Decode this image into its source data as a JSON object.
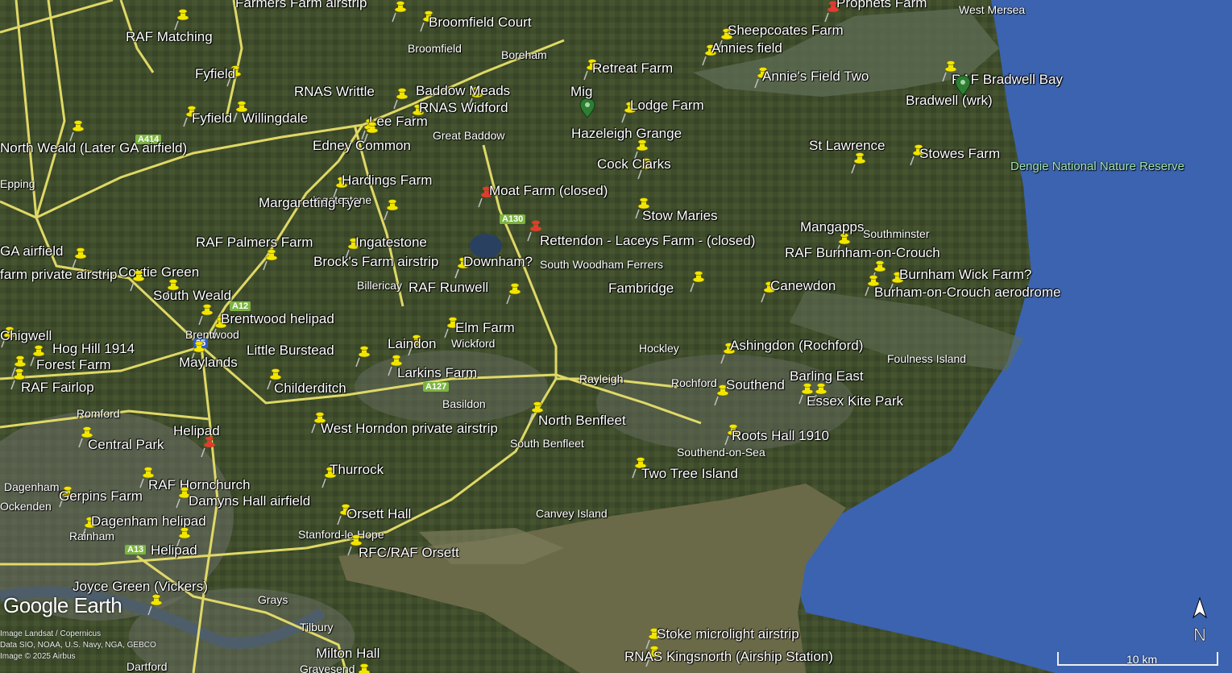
{
  "colors": {
    "land": "#3d4a2c",
    "sea": "#3b63b0",
    "estuary": "#6b6a48",
    "road": "#e8e06a",
    "pin_yellow": "#f2e600",
    "pin_red": "#e53935",
    "pin_green": "#2e7d32"
  },
  "logo": "Google Earth",
  "attribution": [
    "Image Landsat / Copernicus",
    "Data SIO, NOAA, U.S. Navy, NGA, GEBCO",
    "Image © 2025 Airbus"
  ],
  "scale_label": "10 km",
  "compass": "N",
  "places": [
    "West Mersea",
    "Broomfield",
    "Boreham",
    "Great Baddow",
    "Epping",
    "Ingatestone",
    "Billericay",
    "Brentwood",
    "Wickford",
    "Rayleigh",
    "Hockley",
    "Rochford",
    "Southminster",
    "Foulness Island",
    "Romford",
    "Basildon",
    "South Benfleet",
    "Southend-on-Sea",
    "Canvey Island",
    "Stanford-le-Hope",
    "Dagenham",
    "Rainham",
    "Grays",
    "Tilbury",
    "Gravesend",
    "Dartford",
    "Ockenden",
    "South Woodham Ferrers",
    "Dengie National Nature Reserve"
  ],
  "roads": [
    "A130",
    "A12",
    "A127",
    "A13",
    "A414",
    "25"
  ],
  "airfields": [
    {
      "label": "Farmers Farm airstrip",
      "pin": "yellow"
    },
    {
      "label": "Broomfield Court",
      "pin": "yellow"
    },
    {
      "label": "Sheepcoates Farm",
      "pin": "yellow"
    },
    {
      "label": "Prophets Farm",
      "pin": "red"
    },
    {
      "label": "RAF Matching",
      "pin": "yellow"
    },
    {
      "label": "Annies field",
      "pin": "yellow"
    },
    {
      "label": "Retreat Farm",
      "pin": "yellow"
    },
    {
      "label": "Fyfield",
      "pin": "yellow"
    },
    {
      "label": "Annie's Field Two",
      "pin": "yellow"
    },
    {
      "label": "RAF Bradwell Bay",
      "pin": "yellow"
    },
    {
      "label": "RNAS Writtle",
      "pin": "yellow"
    },
    {
      "label": "Baddow Meads",
      "pin": "yellow"
    },
    {
      "label": "Mig",
      "pin": "green"
    },
    {
      "label": "Bradwell (wrk)",
      "pin": "green"
    },
    {
      "label": "RNAS Widford",
      "pin": "yellow"
    },
    {
      "label": "Lodge Farm",
      "pin": "yellow"
    },
    {
      "label": "Fyfield",
      "pin": "yellow"
    },
    {
      "label": "Willingdale",
      "pin": "yellow"
    },
    {
      "label": "Lee Farm",
      "pin": "yellow"
    },
    {
      "label": "Hazeleigh Grange",
      "pin": "yellow"
    },
    {
      "label": "North Weald (Later GA airfield)",
      "pin": "yellow"
    },
    {
      "label": "Edney Common",
      "pin": "yellow"
    },
    {
      "label": "St Lawrence",
      "pin": "yellow"
    },
    {
      "label": "Stowes Farm",
      "pin": "yellow"
    },
    {
      "label": "Cock Clarks",
      "pin": "yellow"
    },
    {
      "label": "Hardings Farm",
      "pin": "yellow"
    },
    {
      "label": "Moat Farm (closed)",
      "pin": "red"
    },
    {
      "label": "Margaretting Tye",
      "pin": "yellow"
    },
    {
      "label": "Stow Maries",
      "pin": "yellow"
    },
    {
      "label": "Mangapps",
      "pin": "yellow"
    },
    {
      "label": "Rettendon - Laceys Farm - (closed)",
      "pin": "red"
    },
    {
      "label": "RAF Palmers Farm",
      "pin": "yellow"
    },
    {
      "label": "Ingatestone",
      "pin": "yellow"
    },
    {
      "label": "RAF Burnham-on-Crouch",
      "pin": "yellow"
    },
    {
      "label": "GA airfield",
      "pin": "yellow"
    },
    {
      "label": "Brock's Farm airstrip",
      "pin": "yellow"
    },
    {
      "label": "Downham?",
      "pin": "yellow"
    },
    {
      "label": "Coxtie Green",
      "pin": "yellow"
    },
    {
      "label": "Burnham Wick Farm?",
      "pin": "yellow"
    },
    {
      "label": "farm private airstrip",
      "pin": "yellow"
    },
    {
      "label": "RAF Runwell",
      "pin": "yellow"
    },
    {
      "label": "Fambridge",
      "pin": "yellow"
    },
    {
      "label": "Canewdon",
      "pin": "yellow"
    },
    {
      "label": "Burham-on-Crouch aerodrome",
      "pin": "yellow"
    },
    {
      "label": "South Weald",
      "pin": "yellow"
    },
    {
      "label": "Brentwood helipad",
      "pin": "yellow"
    },
    {
      "label": "Elm Farm",
      "pin": "yellow"
    },
    {
      "label": "Chigwell",
      "pin": "yellow"
    },
    {
      "label": "Laindon",
      "pin": "yellow"
    },
    {
      "label": "Ashingdon (Rochford)",
      "pin": "yellow"
    },
    {
      "label": "Hog Hill 1914",
      "pin": "yellow"
    },
    {
      "label": "Little Burstead",
      "pin": "yellow"
    },
    {
      "label": "Forest Farm",
      "pin": "yellow"
    },
    {
      "label": "Maylands",
      "pin": "yellow"
    },
    {
      "label": "Larkins Farm",
      "pin": "yellow"
    },
    {
      "label": "Barling East",
      "pin": "yellow"
    },
    {
      "label": "RAF Fairlop",
      "pin": "yellow"
    },
    {
      "label": "Childerditch",
      "pin": "yellow"
    },
    {
      "label": "Southend",
      "pin": "yellow"
    },
    {
      "label": "Essex Kite Park",
      "pin": "yellow"
    },
    {
      "label": "North Benfleet",
      "pin": "yellow"
    },
    {
      "label": "West Horndon private airstrip",
      "pin": "yellow"
    },
    {
      "label": "Roots Hall 1910",
      "pin": "yellow"
    },
    {
      "label": "Helipad",
      "pin": "red"
    },
    {
      "label": "Central Park",
      "pin": "yellow"
    },
    {
      "label": "Thurrock",
      "pin": "yellow"
    },
    {
      "label": "Two Tree Island",
      "pin": "yellow"
    },
    {
      "label": "RAF Hornchurch",
      "pin": "yellow"
    },
    {
      "label": "Gerpins Farm",
      "pin": "yellow"
    },
    {
      "label": "Damyns Hall airfield",
      "pin": "yellow"
    },
    {
      "label": "Orsett Hall",
      "pin": "yellow"
    },
    {
      "label": "Dagenham helipad",
      "pin": "yellow"
    },
    {
      "label": "Helipad",
      "pin": "yellow"
    },
    {
      "label": "RFC/RAF Orsett",
      "pin": "yellow"
    },
    {
      "label": "Joyce Green (Vickers)",
      "pin": "yellow"
    },
    {
      "label": "Stoke microlight airstrip",
      "pin": "yellow"
    },
    {
      "label": "Milton Hall",
      "pin": "yellow"
    },
    {
      "label": "RNAS Kingsnorth (Airship Station)",
      "pin": "yellow"
    }
  ]
}
